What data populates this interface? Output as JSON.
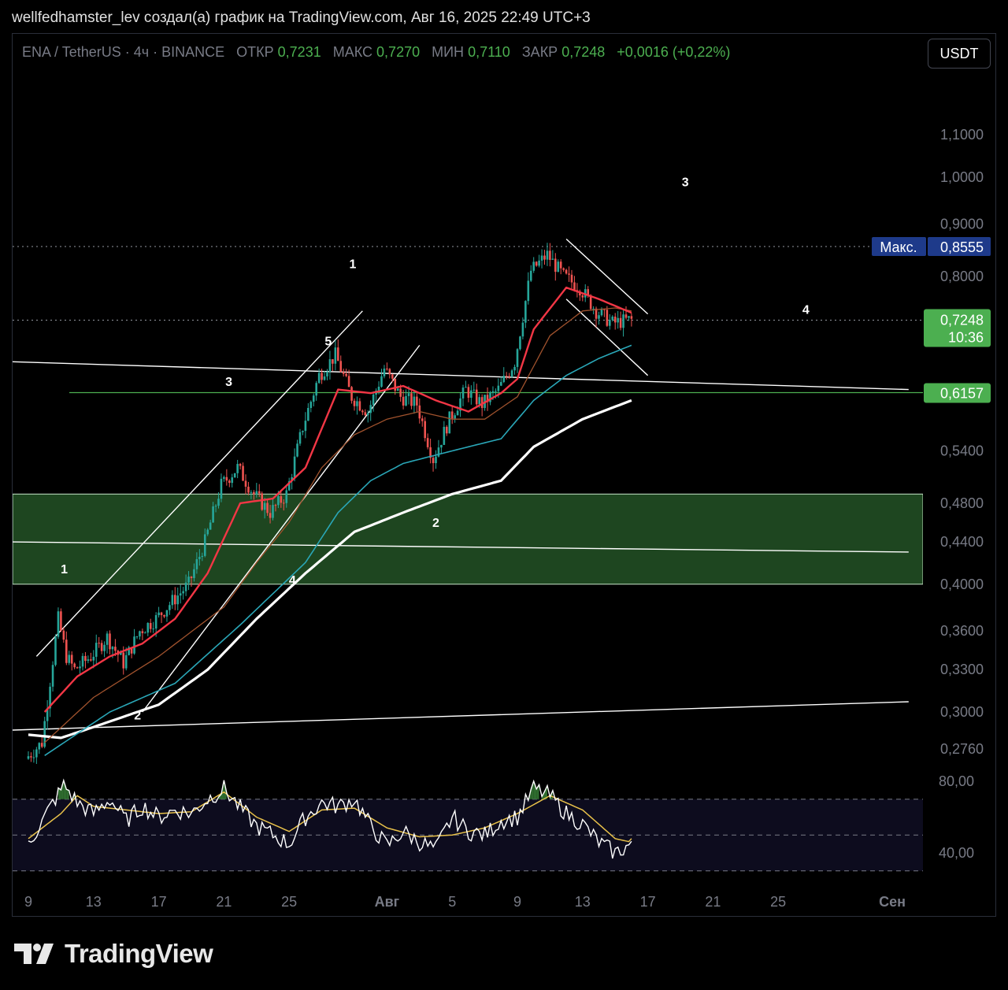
{
  "header": {
    "attribution": "wellfedhamster_lev создал(а) график на TradingView.com, Авг 16, 2025 22:49 UTC+3"
  },
  "legend": {
    "symbol": "ENA / TetherUS · 4ч · BINANCE",
    "open_label": "ОТКР",
    "open": "0,7231",
    "high_label": "МАКС",
    "high": "0,7270",
    "low_label": "МИН",
    "low": "0,7110",
    "close_label": "ЗАКР",
    "close": "0,7248",
    "change": "+0,0016 (+0,22%)"
  },
  "currency": "USDT",
  "footer": {
    "brand": "TradingView"
  },
  "colors": {
    "up": "#26a69a",
    "down": "#ef5350",
    "ema_fast": "#f23645",
    "ema_mid": "#a0522d",
    "ema_slow": "#2aa7b8",
    "ema_long": "#ffffff",
    "zone": "#1e4620",
    "rsi": "#ffffff",
    "rsi_ma": "#e8c14a",
    "price_badge": "#4caf50",
    "max_badge": "#1e3a8a"
  },
  "chart_data": {
    "type": "candlestick",
    "scale": "log",
    "ylim": [
      0.262,
      1.2
    ],
    "y_ticks": [
      "1,1000",
      "1,0000",
      "0,9000",
      "0,8000",
      "0,5400",
      "0,4800",
      "0,4400",
      "0,4000",
      "0,3600",
      "0,3300",
      "0,3000",
      "0,2760"
    ],
    "y_tick_values": [
      1.1,
      1.0,
      0.9,
      0.8,
      0.54,
      0.48,
      0.44,
      0.4,
      0.36,
      0.33,
      0.3,
      0.276
    ],
    "x_ticks": [
      "9",
      "13",
      "17",
      "21",
      "25",
      "Авг",
      "5",
      "9",
      "13",
      "17",
      "21",
      "25",
      "Сен"
    ],
    "x_tick_days": [
      0,
      4,
      8,
      12,
      16,
      22,
      26,
      30,
      34,
      38,
      42,
      46,
      53
    ],
    "x_start": "2025-07-09",
    "price_path": [
      [
        0,
        0.27
      ],
      [
        1,
        0.28
      ],
      [
        2,
        0.37
      ],
      [
        2.5,
        0.34
      ],
      [
        3,
        0.33
      ],
      [
        4,
        0.34
      ],
      [
        5,
        0.355
      ],
      [
        6,
        0.335
      ],
      [
        7,
        0.36
      ],
      [
        8,
        0.37
      ],
      [
        9,
        0.385
      ],
      [
        10,
        0.4
      ],
      [
        11,
        0.44
      ],
      [
        12,
        0.5
      ],
      [
        13,
        0.52
      ],
      [
        14,
        0.49
      ],
      [
        15,
        0.47
      ],
      [
        16,
        0.49
      ],
      [
        17,
        0.57
      ],
      [
        18,
        0.64
      ],
      [
        19,
        0.67
      ],
      [
        20,
        0.61
      ],
      [
        21,
        0.59
      ],
      [
        22,
        0.65
      ],
      [
        23,
        0.61
      ],
      [
        24,
        0.6
      ],
      [
        25,
        0.53
      ],
      [
        26,
        0.58
      ],
      [
        27,
        0.62
      ],
      [
        28,
        0.6
      ],
      [
        29,
        0.62
      ],
      [
        30,
        0.66
      ],
      [
        31,
        0.81
      ],
      [
        32,
        0.84
      ],
      [
        33,
        0.8
      ],
      [
        34,
        0.78
      ],
      [
        35,
        0.74
      ],
      [
        36,
        0.72
      ],
      [
        37,
        0.725
      ]
    ],
    "ema_fast": [
      [
        1,
        0.3
      ],
      [
        3,
        0.325
      ],
      [
        5,
        0.34
      ],
      [
        7,
        0.35
      ],
      [
        9,
        0.37
      ],
      [
        11,
        0.41
      ],
      [
        13,
        0.48
      ],
      [
        15,
        0.485
      ],
      [
        17,
        0.52
      ],
      [
        19,
        0.62
      ],
      [
        21,
        0.615
      ],
      [
        23,
        0.625
      ],
      [
        25,
        0.605
      ],
      [
        27,
        0.59
      ],
      [
        29,
        0.615
      ],
      [
        30,
        0.635
      ],
      [
        31,
        0.71
      ],
      [
        33,
        0.78
      ],
      [
        35,
        0.76
      ],
      [
        37,
        0.737
      ]
    ],
    "ema_mid": [
      [
        1,
        0.28
      ],
      [
        4,
        0.31
      ],
      [
        8,
        0.34
      ],
      [
        12,
        0.38
      ],
      [
        14,
        0.42
      ],
      [
        16,
        0.46
      ],
      [
        18,
        0.52
      ],
      [
        20,
        0.56
      ],
      [
        22,
        0.58
      ],
      [
        24,
        0.59
      ],
      [
        26,
        0.58
      ],
      [
        28,
        0.58
      ],
      [
        30,
        0.61
      ],
      [
        32,
        0.7
      ],
      [
        34,
        0.74
      ],
      [
        36,
        0.745
      ],
      [
        37,
        0.74
      ]
    ],
    "ema_slow": [
      [
        1,
        0.272
      ],
      [
        5,
        0.3
      ],
      [
        9,
        0.32
      ],
      [
        13,
        0.365
      ],
      [
        17,
        0.42
      ],
      [
        19,
        0.47
      ],
      [
        21,
        0.505
      ],
      [
        23,
        0.525
      ],
      [
        25,
        0.535
      ],
      [
        27,
        0.545
      ],
      [
        29,
        0.555
      ],
      [
        31,
        0.605
      ],
      [
        33,
        0.64
      ],
      [
        35,
        0.665
      ],
      [
        37,
        0.685
      ]
    ],
    "ema_long": [
      [
        0,
        0.285
      ],
      [
        2,
        0.283
      ],
      [
        4,
        0.29
      ],
      [
        8,
        0.305
      ],
      [
        11,
        0.33
      ],
      [
        14,
        0.37
      ],
      [
        17,
        0.41
      ],
      [
        20,
        0.45
      ],
      [
        23,
        0.47
      ],
      [
        26,
        0.49
      ],
      [
        29,
        0.505
      ],
      [
        31,
        0.545
      ],
      [
        34,
        0.58
      ],
      [
        37,
        0.605
      ]
    ],
    "horizontal_levels": [
      {
        "label": "Макс.",
        "value": 0.8555,
        "text": "0,8555"
      },
      {
        "label": "",
        "value": 0.7248,
        "text": "0,7248",
        "timer": "10:36"
      },
      {
        "label": "",
        "value": 0.6157,
        "text": "0,6157"
      }
    ],
    "zone": {
      "top": 0.49,
      "bottom": 0.4
    },
    "trend_lines": [
      {
        "from": [
          -1,
          0.66
        ],
        "to": [
          54,
          0.62
        ]
      },
      {
        "from": [
          -1,
          0.44
        ],
        "to": [
          54,
          0.43
        ]
      },
      {
        "from": [
          -1,
          0.288
        ],
        "to": [
          54,
          0.307
        ]
      },
      {
        "from": [
          0.5,
          0.34
        ],
        "to": [
          20.5,
          0.74
        ]
      },
      {
        "from": [
          7,
          0.3
        ],
        "to": [
          24,
          0.685
        ]
      },
      {
        "from": [
          33,
          0.87
        ],
        "to": [
          38,
          0.735
        ]
      },
      {
        "from": [
          33,
          0.76
        ],
        "to": [
          38,
          0.64
        ]
      }
    ],
    "wave_labels": [
      {
        "text": "1",
        "day": 2.2,
        "price": 0.41
      },
      {
        "text": "2",
        "day": 6.7,
        "price": 0.295
      },
      {
        "text": "3",
        "day": 12.3,
        "price": 0.625
      },
      {
        "text": "4",
        "day": 16.2,
        "price": 0.4
      },
      {
        "text": "5",
        "day": 18.4,
        "price": 0.685
      },
      {
        "text": "1",
        "day": 19.9,
        "price": 0.815
      },
      {
        "text": "2",
        "day": 25.0,
        "price": 0.455
      },
      {
        "text": "3",
        "day": 40.3,
        "price": 0.98
      },
      {
        "text": "4",
        "day": 47.7,
        "price": 0.735
      }
    ],
    "rsi": {
      "y_ticks": [
        "80,00",
        "40,00"
      ],
      "y_tick_values": [
        80,
        40
      ],
      "band": [
        70,
        30
      ],
      "mid": 50,
      "line": [
        [
          0,
          46
        ],
        [
          0.7,
          55
        ],
        [
          1.5,
          68
        ],
        [
          2.2,
          78
        ],
        [
          3,
          68
        ],
        [
          4,
          62
        ],
        [
          5,
          70
        ],
        [
          6,
          58
        ],
        [
          7,
          66
        ],
        [
          8,
          60
        ],
        [
          9,
          64
        ],
        [
          10,
          62
        ],
        [
          11,
          70
        ],
        [
          12,
          76
        ],
        [
          13,
          65
        ],
        [
          14,
          55
        ],
        [
          15,
          50
        ],
        [
          16,
          45
        ],
        [
          17,
          60
        ],
        [
          18,
          68
        ],
        [
          19,
          66
        ],
        [
          20,
          70
        ],
        [
          21,
          55
        ],
        [
          22,
          44
        ],
        [
          23,
          52
        ],
        [
          24,
          46
        ],
        [
          25,
          42
        ],
        [
          26,
          60
        ],
        [
          27,
          52
        ],
        [
          28,
          50
        ],
        [
          29,
          58
        ],
        [
          30,
          60
        ],
        [
          31,
          76
        ],
        [
          32,
          72
        ],
        [
          33,
          62
        ],
        [
          34,
          56
        ],
        [
          35,
          46
        ],
        [
          36,
          40
        ],
        [
          37,
          45
        ]
      ],
      "ma": [
        [
          0,
          48
        ],
        [
          2,
          62
        ],
        [
          3,
          72
        ],
        [
          4,
          66
        ],
        [
          6,
          64
        ],
        [
          8,
          62
        ],
        [
          10,
          63
        ],
        [
          12,
          74
        ],
        [
          14,
          60
        ],
        [
          16,
          52
        ],
        [
          18,
          64
        ],
        [
          20,
          65
        ],
        [
          22,
          54
        ],
        [
          24,
          49
        ],
        [
          26,
          50
        ],
        [
          28,
          54
        ],
        [
          30,
          62
        ],
        [
          32,
          72
        ],
        [
          34,
          64
        ],
        [
          36,
          48
        ],
        [
          37,
          46
        ]
      ]
    }
  }
}
